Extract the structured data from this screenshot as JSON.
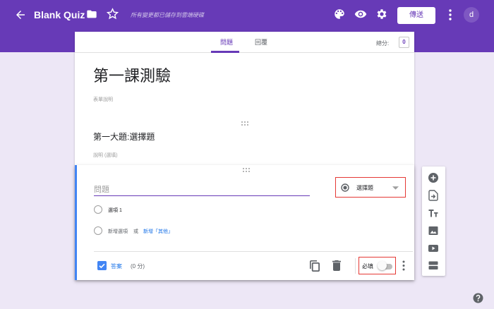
{
  "app": {
    "title": "Blank Quiz",
    "saved_status": "所有變更都已儲存到雲端硬碟",
    "send_label": "傳送",
    "avatar_initial": "d"
  },
  "tabs": [
    {
      "label": "問題",
      "active": true
    },
    {
      "label": "回覆",
      "active": false
    }
  ],
  "score": {
    "label": "總分:",
    "value": "0"
  },
  "form": {
    "title": "第一課測驗",
    "description_placeholder": "表單說明"
  },
  "section": {
    "title": "第一大題:選擇題",
    "description_placeholder": "說明 (選填)"
  },
  "question": {
    "placeholder": "問題",
    "type": "選擇題",
    "options": [
      "選項 1"
    ],
    "add_option": "新增選項",
    "or": "或",
    "add_other": "新增「其他」",
    "answer_key_label": "答案",
    "points": "(0 分)",
    "required_label": "必填",
    "required": false
  },
  "colors": {
    "accent": "#673ab7",
    "background": "#ede7f6",
    "active_border": "#4285f4",
    "highlight_box": "#e53935"
  }
}
